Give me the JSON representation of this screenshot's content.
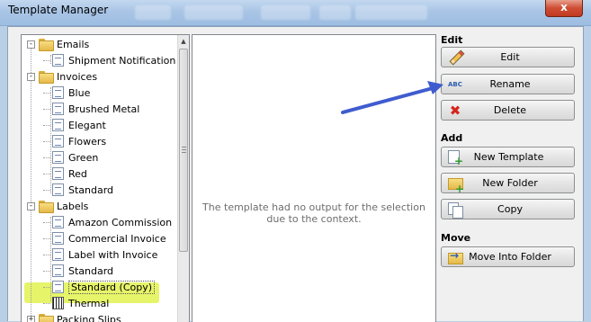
{
  "window": {
    "title": "Template Manager",
    "close_glyph": "x"
  },
  "tree": {
    "items": [
      {
        "label": "Emails",
        "kind": "folder",
        "toggle": "-"
      },
      {
        "label": "Shipment Notification",
        "kind": "template"
      },
      {
        "label": "Invoices",
        "kind": "folder",
        "toggle": "-"
      },
      {
        "label": "Blue",
        "kind": "template"
      },
      {
        "label": "Brushed Metal",
        "kind": "template"
      },
      {
        "label": "Elegant",
        "kind": "template"
      },
      {
        "label": "Flowers",
        "kind": "template"
      },
      {
        "label": "Green",
        "kind": "template"
      },
      {
        "label": "Red",
        "kind": "template"
      },
      {
        "label": "Standard",
        "kind": "template"
      },
      {
        "label": "Labels",
        "kind": "folder",
        "toggle": "-"
      },
      {
        "label": "Amazon Commission",
        "kind": "template"
      },
      {
        "label": "Commercial Invoice",
        "kind": "template"
      },
      {
        "label": "Label with Invoice",
        "kind": "template"
      },
      {
        "label": "Standard",
        "kind": "template"
      },
      {
        "label": "Standard (Copy)",
        "kind": "template",
        "selected": true
      },
      {
        "label": "Thermal",
        "kind": "label-template"
      },
      {
        "label": "Packing Slips",
        "kind": "folder",
        "toggle": "+"
      }
    ]
  },
  "preview": {
    "message": "The template had no output for the selection due to the context."
  },
  "sections": {
    "edit": {
      "title": "Edit",
      "buttons": [
        {
          "label": "Edit",
          "icon": "pencil-icon"
        },
        {
          "label": "Rename",
          "icon": "abc-rename-icon",
          "icon_text": "ABC"
        },
        {
          "label": "Delete",
          "icon": "delete-x-icon",
          "icon_text": "✖"
        }
      ]
    },
    "add": {
      "title": "Add",
      "buttons": [
        {
          "label": "New Template",
          "icon": "new-template-icon"
        },
        {
          "label": "New Folder",
          "icon": "new-folder-icon"
        },
        {
          "label": "Copy",
          "icon": "copy-icon"
        }
      ]
    },
    "move": {
      "title": "Move",
      "buttons": [
        {
          "label": "Move Into Folder",
          "icon": "move-folder-icon"
        }
      ]
    }
  },
  "colors": {
    "highlight": "#e6f46a",
    "annotation_arrow": "#3f5ccf"
  }
}
